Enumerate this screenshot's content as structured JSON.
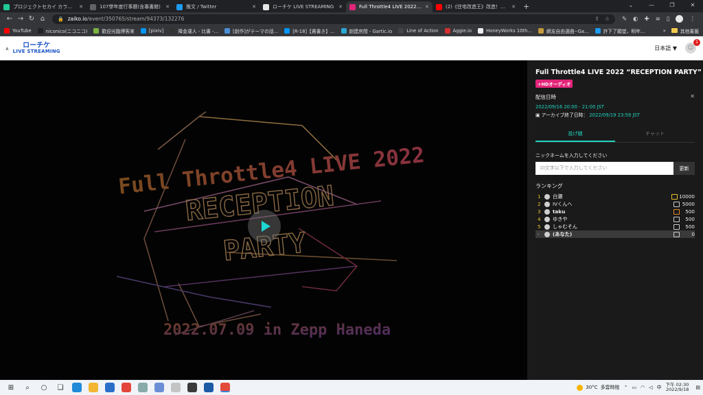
{
  "browser": {
    "tabs": [
      {
        "label": "プロジェクトセカイ カラフルステージ",
        "color": "#20c997",
        "active": false
      },
      {
        "label": "107學年度行事曆(含專書館)",
        "color": "#5f6368",
        "active": false
      },
      {
        "label": "推文 / Twitter",
        "color": "#1d9bf0",
        "active": false
      },
      {
        "label": "ローチケ LIVE STREAMING",
        "color": "#e6e6e6",
        "active": false
      },
      {
        "label": "Full Throttle4 LIVE 2022 \"RECEPTION",
        "color": "#e3257a",
        "active": true
      },
      {
        "label": "(2)《住宅改造王》改造！邁滿部",
        "color": "#ff0000",
        "active": false
      }
    ],
    "url_host": "zaiko.io",
    "url_path": "/event/350765/stream/94373/132276",
    "bookmarks": [
      {
        "label": "YouTube",
        "color": "#ff0000"
      },
      {
        "label": "niconico(ニコニコ)",
        "color": "#222222"
      },
      {
        "label": "歡迎光臨博客來",
        "color": "#7cb342"
      },
      {
        "label": "[pixiv]",
        "color": "#0096fa"
      },
      {
        "label": "降金運人 - 比書 -...",
        "color": "#333333"
      },
      {
        "label": "[創作]がテーマの話...",
        "color": "#4a90d9"
      },
      {
        "label": "[R-18]【責書き】...",
        "color": "#0096fa"
      },
      {
        "label": "創建房間 - Gartic.io",
        "color": "#2aa8d4"
      },
      {
        "label": "Line of Action",
        "color": "#444444"
      },
      {
        "label": "Aggie.io",
        "color": "#d32f2f"
      },
      {
        "label": "HoneyWorks 10th...",
        "color": "#eeeeee"
      },
      {
        "label": "網友自由選曲--Ga...",
        "color": "#c49a3c"
      },
      {
        "label": "許下了願望，明年...",
        "color": "#1d9bf0"
      }
    ],
    "bookmarks_more": "»",
    "other_bookmarks": "其他書籤"
  },
  "site": {
    "logo_top": "ローチケ",
    "logo_bottom": "LIVE STREAMING",
    "language": "日本語 ▼",
    "notification_count": "1"
  },
  "video": {
    "line1": "Full Throttle4 LIVE 2022",
    "line2": "RECEPTION",
    "line3": "PARTY",
    "line4": "2022.07.09 in Zepp Haneda"
  },
  "panel": {
    "title": "Full Throttle4 LIVE 2022 “RECEPTION PARTY”",
    "badge": "+HDオーディオ",
    "schedule_label": "配信日時",
    "schedule_time": "2022/09/16 20:00 - 21:00 JST",
    "archive_label": "アーカイブ終了日時：",
    "archive_value": "2022/09/19 23:59 JST",
    "tabs": [
      "投げ銭",
      "チャット"
    ],
    "nickname_label": "ニックネームを入力してください",
    "nickname_placeholder": "10文字以下で入力してください",
    "update_button": "更新",
    "ranking_title": "ランキング",
    "ranking": [
      {
        "rank": "1",
        "name": "白瀬",
        "score": "10000",
        "gift": "gold",
        "bold": false
      },
      {
        "rank": "2",
        "name": "IVくんへ",
        "score": "5000",
        "gift": "white",
        "bold": false
      },
      {
        "rank": "3",
        "name": "taku",
        "score": "500",
        "gift": "orange",
        "bold": true
      },
      {
        "rank": "4",
        "name": "ゆきや",
        "score": "500",
        "gift": "white",
        "bold": false
      },
      {
        "rank": "5",
        "name": "しゃむそん",
        "score": "500",
        "gift": "white",
        "bold": false
      },
      {
        "rank": "-",
        "name": "(あなた)",
        "score": "0",
        "gift": "white",
        "bold": true,
        "mine": true
      }
    ]
  },
  "taskbar": {
    "temperature": "30°C",
    "weather": "多雲時陰",
    "time": "下午 02:30",
    "date": "2022/9/18"
  }
}
